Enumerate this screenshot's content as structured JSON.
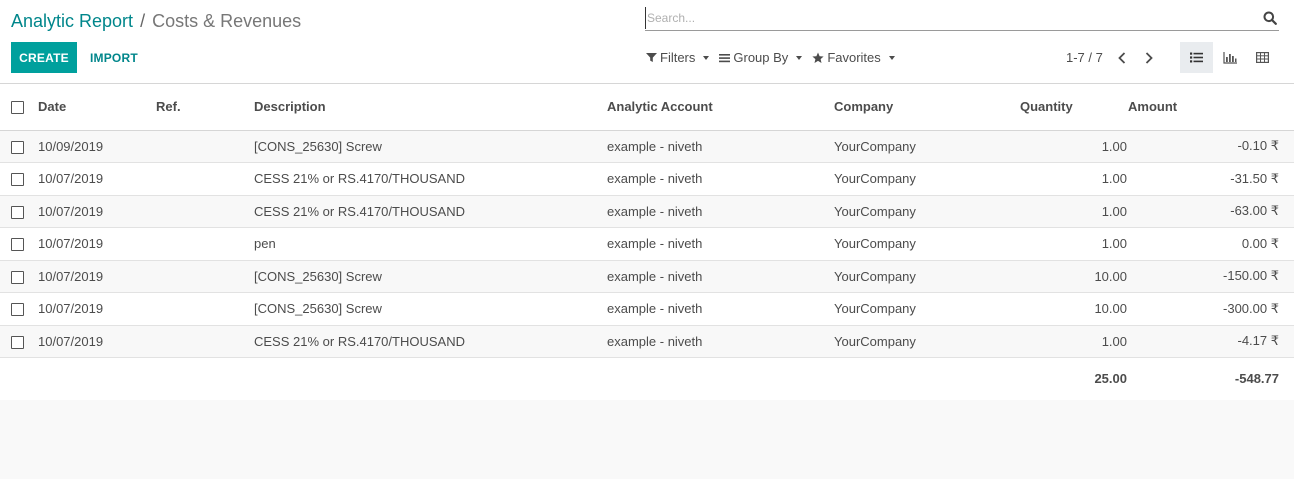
{
  "breadcrumb": {
    "parent": "Analytic Report",
    "separator": "/",
    "current": "Costs & Revenues"
  },
  "buttons": {
    "create": "CREATE",
    "import": "IMPORT"
  },
  "search": {
    "placeholder": "Search...",
    "icon": "search-icon"
  },
  "search_options": {
    "filters": "Filters",
    "group_by": "Group By",
    "favorites": "Favorites"
  },
  "pager": {
    "text": "1-7 / 7"
  },
  "views": {
    "list": "list-icon",
    "graph": "bar-chart-icon",
    "pivot": "pivot-table-icon",
    "active": "list"
  },
  "table": {
    "columns": [
      "Date",
      "Ref.",
      "Description",
      "Analytic Account",
      "Company",
      "Quantity",
      "Amount"
    ],
    "rows": [
      {
        "date": "10/09/2019",
        "ref": "",
        "description": "[CONS_25630] Screw",
        "account": "example - niveth",
        "company": "YourCompany",
        "quantity": "1.00",
        "amount": "-0.10 ₹"
      },
      {
        "date": "10/07/2019",
        "ref": "",
        "description": "CESS 21% or RS.4170/THOUSAND",
        "account": "example - niveth",
        "company": "YourCompany",
        "quantity": "1.00",
        "amount": "-31.50 ₹"
      },
      {
        "date": "10/07/2019",
        "ref": "",
        "description": "CESS 21% or RS.4170/THOUSAND",
        "account": "example - niveth",
        "company": "YourCompany",
        "quantity": "1.00",
        "amount": "-63.00 ₹"
      },
      {
        "date": "10/07/2019",
        "ref": "",
        "description": "pen",
        "account": "example - niveth",
        "company": "YourCompany",
        "quantity": "1.00",
        "amount": "0.00 ₹"
      },
      {
        "date": "10/07/2019",
        "ref": "",
        "description": "[CONS_25630] Screw",
        "account": "example - niveth",
        "company": "YourCompany",
        "quantity": "10.00",
        "amount": "-150.00 ₹"
      },
      {
        "date": "10/07/2019",
        "ref": "",
        "description": "[CONS_25630] Screw",
        "account": "example - niveth",
        "company": "YourCompany",
        "quantity": "10.00",
        "amount": "-300.00 ₹"
      },
      {
        "date": "10/07/2019",
        "ref": "",
        "description": "CESS 21% or RS.4170/THOUSAND",
        "account": "example - niveth",
        "company": "YourCompany",
        "quantity": "1.00",
        "amount": "-4.17 ₹"
      }
    ],
    "totals": {
      "quantity": "25.00",
      "amount": "-548.77"
    }
  },
  "colors": {
    "accent": "#00a09d",
    "link": "#00868b",
    "text": "#4c4c4c"
  }
}
